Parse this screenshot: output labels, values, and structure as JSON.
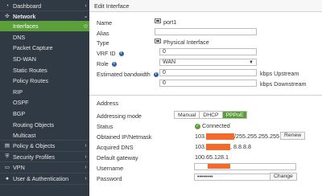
{
  "sidebar": {
    "items": [
      {
        "label": "Dashboard",
        "icon": "dashboard-icon",
        "glyph": "◔",
        "chevron": "›"
      },
      {
        "label": "Network",
        "icon": "network-icon",
        "glyph": "✣",
        "chevron": "⌄"
      },
      {
        "label": "Interfaces",
        "chevron": "☆"
      },
      {
        "label": "DNS"
      },
      {
        "label": "Packet Capture"
      },
      {
        "label": "SD-WAN"
      },
      {
        "label": "Static Routes"
      },
      {
        "label": "Policy Routes"
      },
      {
        "label": "RIP"
      },
      {
        "label": "OSPF"
      },
      {
        "label": "BGP"
      },
      {
        "label": "Routing Objects"
      },
      {
        "label": "Multicast"
      },
      {
        "label": "Policy & Objects",
        "icon": "policy-icon",
        "glyph": "▤",
        "chevron": "›"
      },
      {
        "label": "Security Profiles",
        "icon": "security-icon",
        "glyph": "⛨",
        "chevron": "›"
      },
      {
        "label": "VPN",
        "icon": "vpn-icon",
        "glyph": "▭",
        "chevron": "›"
      },
      {
        "label": "User & Authentication",
        "icon": "user-icon",
        "glyph": "●",
        "chevron": "›"
      }
    ]
  },
  "header": {
    "title": "Edit Interface"
  },
  "form": {
    "name_label": "Name",
    "name_value": "port1",
    "alias_label": "Alias",
    "alias_value": "",
    "type_label": "Type",
    "type_value": "Physical Interface",
    "vrf_label": "VRF ID",
    "vrf_value": "0",
    "role_label": "Role",
    "role_value": "WAN",
    "bw_label": "Estimated bandwidth",
    "bw_up_value": "0",
    "bw_up_unit": "kbps Upstream",
    "bw_down_value": "0",
    "bw_down_unit": "kbps Downstream",
    "info_glyph": "i"
  },
  "address": {
    "section_title": "Address",
    "mode_label": "Addressing mode",
    "modes": [
      "Manual",
      "DHCP",
      "PPPoE"
    ],
    "selected_mode": "PPPoE",
    "status_label": "Status",
    "status_value": "Connected",
    "obtained_label": "Obtained IP/Netmask",
    "obtained_prefix": "103.",
    "obtained_suffix": "/255.255.255.255",
    "renew_label": "Renew",
    "dns_label": "Acquired DNS",
    "dns_prefix": "103.",
    "dns_suffix": ", 8.8.8.8",
    "gateway_label": "Default gateway",
    "gateway_value": "100.65.128.1",
    "username_label": "Username",
    "password_label": "Password",
    "password_value": "••••••••",
    "change_label": "Change"
  },
  "colors": {
    "sidebar_bg": "#2f3a45",
    "accent_green": "#5b9f3a",
    "redaction_orange": "#f26b2a",
    "info_blue": "#2e63a8"
  }
}
